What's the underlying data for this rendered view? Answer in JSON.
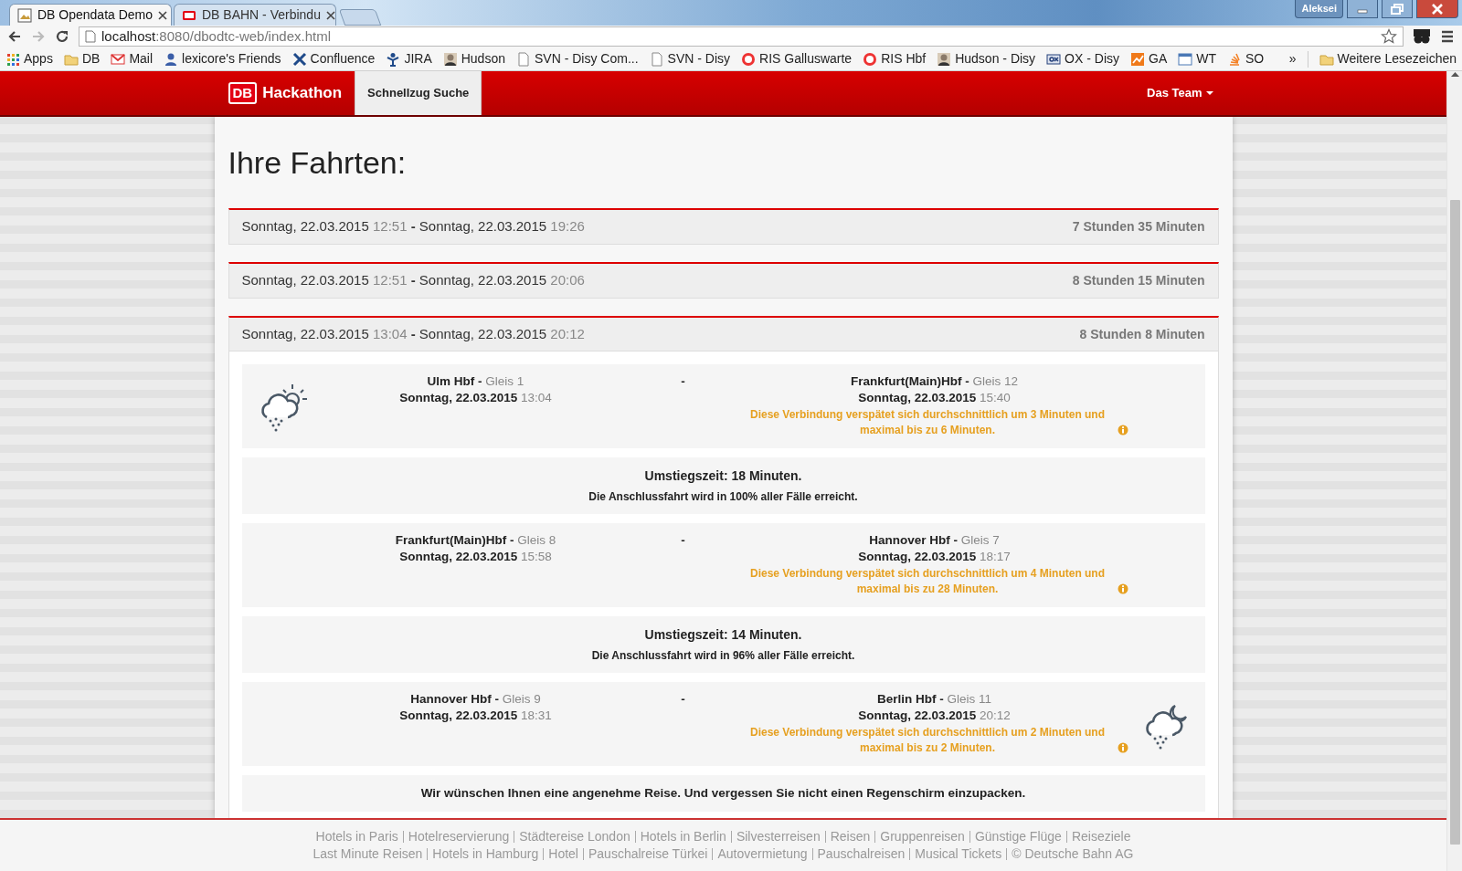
{
  "browser": {
    "tabs": [
      {
        "title": "DB Opendata Demo",
        "selected": true,
        "kind": "image"
      },
      {
        "title": "DB BAHN - Verbindu",
        "selected": false,
        "kind": "db"
      }
    ],
    "profile": "Aleksei",
    "address": {
      "host": "localhost",
      "path": ":8080/dbodtc-web/index.html"
    },
    "bookmarks": [
      {
        "label": "Apps",
        "kind": "apps"
      },
      {
        "label": "DB",
        "kind": "folder"
      },
      {
        "label": "Mail",
        "kind": "mail"
      },
      {
        "label": "lexicore's Friends",
        "kind": "person"
      },
      {
        "label": "Confluence",
        "kind": "cross"
      },
      {
        "label": "JIRA",
        "kind": "figure"
      },
      {
        "label": "Hudson",
        "kind": "avatar"
      },
      {
        "label": "SVN - Disy Com...",
        "kind": "page"
      },
      {
        "label": "SVN - Disy",
        "kind": "page"
      },
      {
        "label": "RIS Galluswarte",
        "kind": "ris"
      },
      {
        "label": "RIS Hbf",
        "kind": "ris"
      },
      {
        "label": "Hudson - Disy",
        "kind": "avatar"
      },
      {
        "label": "OX - Disy",
        "kind": "box"
      },
      {
        "label": "GA",
        "kind": "chart"
      },
      {
        "label": "WT",
        "kind": "window"
      },
      {
        "label": "SO",
        "kind": "stack"
      }
    ],
    "overflow": "»",
    "other_bookmarks": "Weitere Lesezeichen"
  },
  "navbar": {
    "logo": "DB",
    "brand": "Hackathon",
    "items": [
      {
        "label": "Schnellzug Suche",
        "selected": true
      }
    ],
    "menu": "Das Team"
  },
  "heading": "Ihre Fahrten:",
  "trips": [
    {
      "departure": {
        "date": "Sonntag, 22.03.2015",
        "time": "12:51"
      },
      "separator": "-",
      "arrival": {
        "date": "Sonntag, 22.03.2015",
        "time": "19:26"
      },
      "duration": "7 Stunden 35 Minuten",
      "expanded": false
    },
    {
      "departure": {
        "date": "Sonntag, 22.03.2015",
        "time": "12:51"
      },
      "separator": "-",
      "arrival": {
        "date": "Sonntag, 22.03.2015",
        "time": "20:06"
      },
      "duration": "8 Stunden 15 Minuten",
      "expanded": false
    },
    {
      "departure": {
        "date": "Sonntag, 22.03.2015",
        "time": "13:04"
      },
      "separator": "-",
      "arrival": {
        "date": "Sonntag, 22.03.2015",
        "time": "20:12"
      },
      "duration": "8 Stunden 8 Minuten",
      "expanded": true,
      "details": [
        {
          "kind": "leg",
          "from": {
            "station": "Ulm Hbf -",
            "track": "Gleis 1",
            "date": "Sonntag, 22.03.2015",
            "time": "13:04",
            "weather": {
              "kind": "day-rain"
            }
          },
          "separator": "-",
          "to": {
            "station": "Frankfurt(Main)Hbf -",
            "track": "Gleis 12",
            "date": "Sonntag, 22.03.2015",
            "time": "15:40"
          },
          "delay_note": "Diese Verbindung verspätet sich durchschnittlich um 3 Minuten und maximal bis zu 6 Minuten."
        },
        {
          "kind": "transfer",
          "title": "Umstiegszeit: 18 Minuten.",
          "note": "Die Anschlussfahrt wird in 100% aller Fälle erreicht."
        },
        {
          "kind": "leg",
          "from": {
            "station": "Frankfurt(Main)Hbf -",
            "track": "Gleis 8",
            "date": "Sonntag, 22.03.2015",
            "time": "15:58"
          },
          "separator": "-",
          "to": {
            "station": "Hannover Hbf -",
            "track": "Gleis 7",
            "date": "Sonntag, 22.03.2015",
            "time": "18:17"
          },
          "delay_note": "Diese Verbindung verspätet sich durchschnittlich um 4 Minuten und maximal bis zu 28 Minuten."
        },
        {
          "kind": "transfer",
          "title": "Umstiegszeit: 14 Minuten.",
          "note": "Die Anschlussfahrt wird in 96% aller Fälle erreicht."
        },
        {
          "kind": "leg",
          "from": {
            "station": "Hannover Hbf -",
            "track": "Gleis 9",
            "date": "Sonntag, 22.03.2015",
            "time": "18:31"
          },
          "separator": "-",
          "to": {
            "station": "Berlin Hbf -",
            "track": "Gleis 11",
            "date": "Sonntag, 22.03.2015",
            "time": "20:12",
            "weather": {
              "kind": "night-rain"
            }
          },
          "delay_note": "Diese Verbindung verspätet sich durchschnittlich um 2 Minuten und maximal bis zu 2 Minuten."
        },
        {
          "kind": "message",
          "text": "Wir wünschen Ihnen eine angenehme Reise. Und vergessen Sie nicht einen Regenschirm einzupacken."
        }
      ]
    }
  ],
  "footer": {
    "rows": [
      [
        "Hotels in Paris",
        "Hotelreservierung",
        "Städtereise London",
        "Hotels in Berlin",
        "Silvesterreisen",
        "Reisen",
        "Gruppenreisen",
        "Günstige Flüge",
        "Reiseziele"
      ],
      [
        "Last Minute Reisen",
        "Hotels in Hamburg",
        "Hotel",
        "Pauschalreise Türkei",
        "Autovermietung",
        "Pauschalreisen",
        "Musical Tickets"
      ]
    ],
    "copyright": "© Deutsche Bahn AG"
  }
}
